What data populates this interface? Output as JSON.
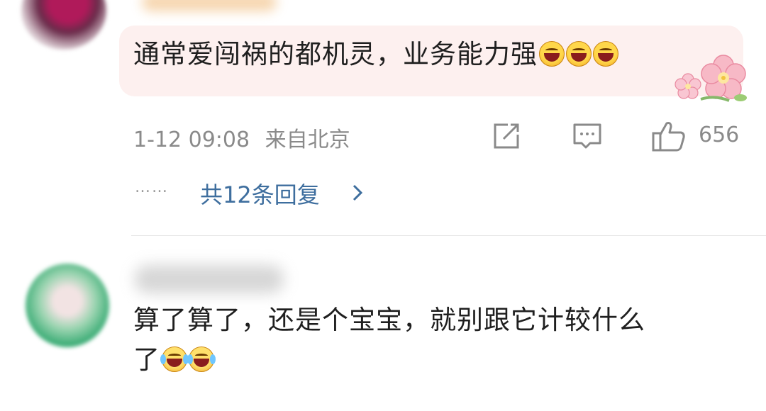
{
  "comment_1": {
    "text": "通常爱闯祸的都机灵，业务能力强",
    "emojis": [
      "grin-emoji",
      "grin-emoji",
      "grin-emoji"
    ],
    "bubble_color": "#fdf0ef",
    "decoration": "cherry-blossom-icon",
    "time": "1-12 09:08",
    "location": "来自北京",
    "like_count": "656",
    "replies_label": "共12条回复",
    "dots": "……"
  },
  "comment_2": {
    "text_line_1": "算了算了，还是个宝宝，就别跟它计较什么",
    "text_line_2": "了",
    "emojis": [
      "laugh-cry-emoji",
      "laugh-cry-emoji"
    ]
  },
  "colors": {
    "meta_gray": "#8a8a8a",
    "link_blue": "#3e6e9e",
    "divider": "#e6e6e6"
  }
}
